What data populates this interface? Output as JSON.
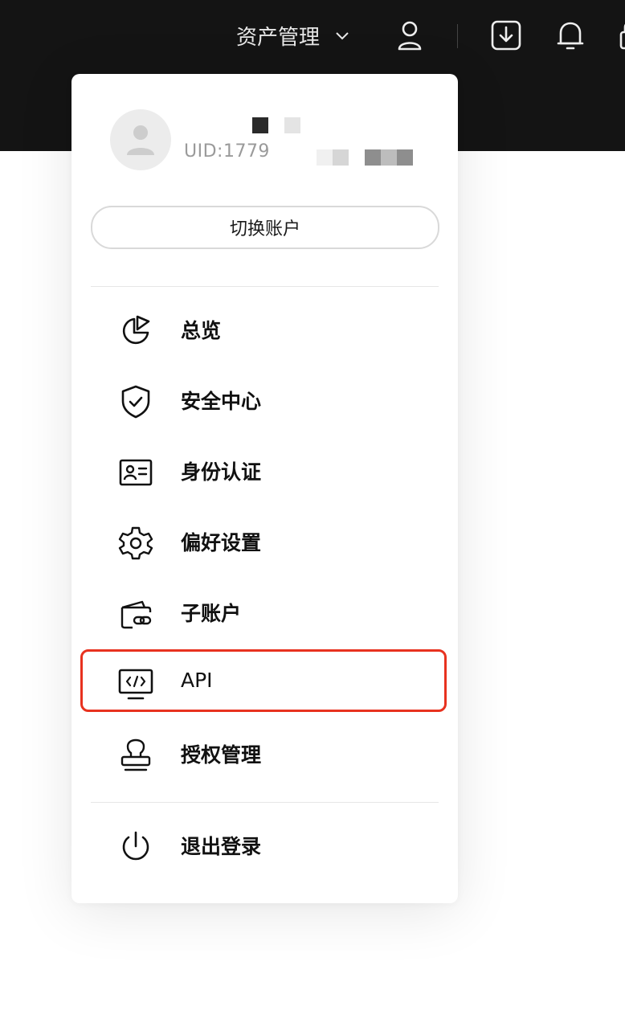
{
  "topbar": {
    "asset_menu_label": "资产管理",
    "icons": [
      "user-icon",
      "download-icon",
      "bell-icon",
      "lock-icon"
    ]
  },
  "account": {
    "uid_text": "UID:1779",
    "switch_label": "切换账户"
  },
  "menu": {
    "items": [
      {
        "label": "总览",
        "icon": "pie-chart-icon"
      },
      {
        "label": "安全中心",
        "icon": "shield-check-icon"
      },
      {
        "label": "身份认证",
        "icon": "id-card-icon"
      },
      {
        "label": "偏好设置",
        "icon": "gear-icon"
      },
      {
        "label": "子账户",
        "icon": "wallet-link-icon"
      },
      {
        "label": "API",
        "icon": "api-monitor-icon"
      },
      {
        "label": "授权管理",
        "icon": "stamp-icon"
      }
    ],
    "logout_label": "退出登录"
  },
  "colors": {
    "topbar": "#141414",
    "highlight": "#e8321f",
    "text": "#111111",
    "muted": "#9a9a9a"
  }
}
